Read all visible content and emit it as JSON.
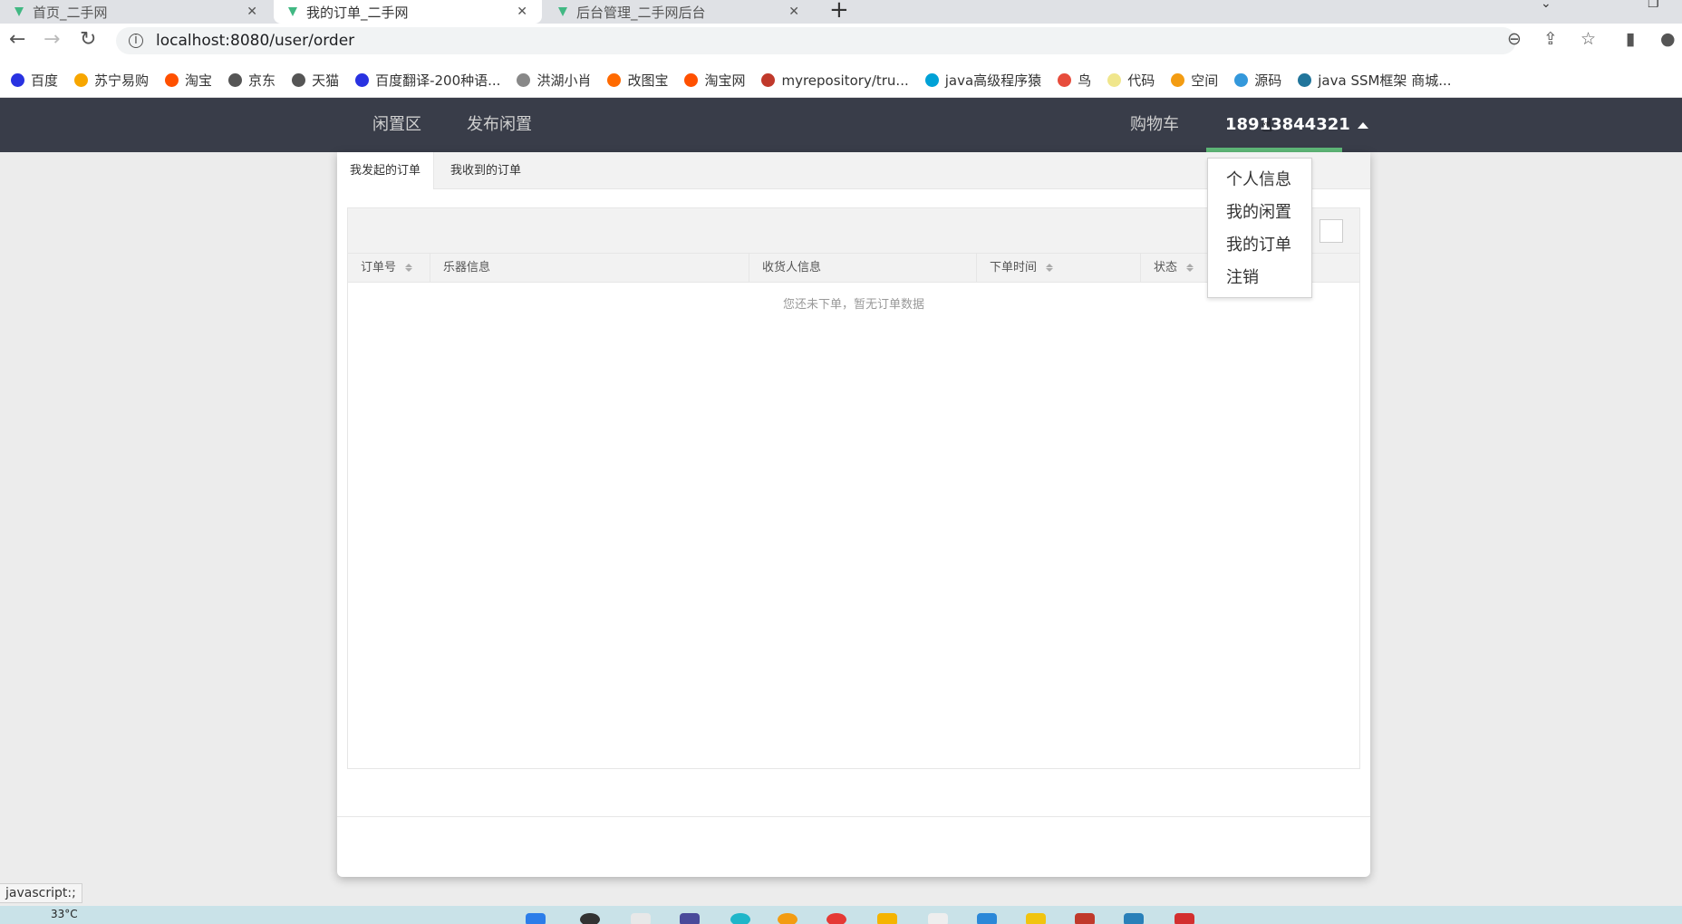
{
  "browser": {
    "tabs": [
      {
        "title": "首页_二手网"
      },
      {
        "title": "我的订单_二手网"
      },
      {
        "title": "后台管理_二手网后台"
      }
    ],
    "url": "localhost:8080/user/order",
    "bookmarks": [
      {
        "label": "百度",
        "color": "#2932e1"
      },
      {
        "label": "苏宁易购",
        "color": "#f7a600"
      },
      {
        "label": "淘宝",
        "color": "#ff5000"
      },
      {
        "label": "京东",
        "color": "#555555"
      },
      {
        "label": "天猫",
        "color": "#555555"
      },
      {
        "label": "百度翻译-200种语...",
        "color": "#2932e1"
      },
      {
        "label": "洪湖小肖",
        "color": "#888888"
      },
      {
        "label": "改图宝",
        "color": "#ff6a00"
      },
      {
        "label": "淘宝网",
        "color": "#ff5000"
      },
      {
        "label": "myrepository/tru...",
        "color": "#c0392b"
      },
      {
        "label": "java高级程序猿",
        "color": "#00a1d6"
      },
      {
        "label": "鸟",
        "color": "#e74c3c"
      },
      {
        "label": "代码",
        "color": "#f0e68c"
      },
      {
        "label": "空间",
        "color": "#f39c12"
      },
      {
        "label": "源码",
        "color": "#3498db"
      },
      {
        "label": "java SSM框架 商城...",
        "color": "#21759b"
      }
    ],
    "status_text": "javascript:;"
  },
  "navbar": {
    "left_links": [
      "闲置区",
      "发布闲置"
    ],
    "cart": "购物车",
    "user": "18913844321"
  },
  "dropdown": {
    "items": [
      "个人信息",
      "我的闲置",
      "我的订单",
      "注销"
    ]
  },
  "orders": {
    "tabs": [
      "我发起的订单",
      "我收到的订单"
    ],
    "columns": [
      "订单号",
      "乐器信息",
      "收货人信息",
      "下单时间",
      "状态"
    ],
    "empty_text": "您还未下单，暂无订单数据"
  },
  "taskbar": {
    "weather": "33°C"
  },
  "colors": {
    "navbar_bg": "#393d49",
    "accent": "#5fb878"
  }
}
